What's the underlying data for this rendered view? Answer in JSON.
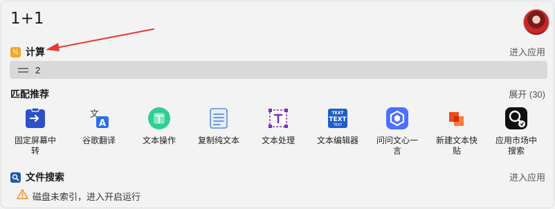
{
  "search": {
    "query": "1+1"
  },
  "calc": {
    "title": "计算",
    "action": "进入应用",
    "result": "2"
  },
  "match": {
    "title": "匹配推荐",
    "expand": "展开 (30)"
  },
  "apps": [
    {
      "label": "固定屏幕中转",
      "icon": "pin-screen-icon",
      "color": "#2c50c8"
    },
    {
      "label": "谷歌翻译",
      "icon": "translate-icon",
      "color": "#2a6ee8"
    },
    {
      "label": "文本操作",
      "icon": "text-ops-icon",
      "color": "#2fcf92"
    },
    {
      "label": "复制纯文本",
      "icon": "copy-text-icon",
      "color": "#5a8fd8"
    },
    {
      "label": "文本处理",
      "icon": "text-process-icon",
      "color": "#7b2fb8"
    },
    {
      "label": "文本编辑器",
      "icon": "text-editor-icon",
      "color": "#1f5dc9"
    },
    {
      "label": "问问文心一言",
      "icon": "wenxin-icon",
      "color": "#4c6fff"
    },
    {
      "label": "新建文本快贴",
      "icon": "sticky-note-icon",
      "color": "#f04a1a"
    },
    {
      "label": "应用市场中搜索",
      "icon": "app-market-search-icon",
      "color": "#111111"
    }
  ],
  "file_search": {
    "title": "文件搜索",
    "action": "进入应用",
    "warning": "磁盘未索引，进入开启运行"
  },
  "colors": {
    "accent_arrow": "#e53935",
    "calc_icon": "#f6a623",
    "file_icon": "#1e5aa8",
    "warning": "#f08a24"
  }
}
